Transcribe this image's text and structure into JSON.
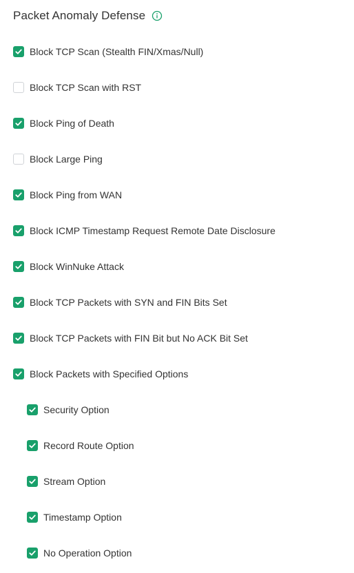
{
  "section": {
    "title": "Packet Anomaly Defense",
    "info_icon": "info-circle-icon"
  },
  "colors": {
    "accent": "#19a06b",
    "text": "#333333",
    "checkbox_border": "#d0d3d7"
  },
  "options": [
    {
      "label": "Block TCP Scan (Stealth FIN/Xmas/Null)",
      "checked": true,
      "level": 0
    },
    {
      "label": "Block TCP Scan with RST",
      "checked": false,
      "level": 0
    },
    {
      "label": "Block Ping of Death",
      "checked": true,
      "level": 0
    },
    {
      "label": "Block Large Ping",
      "checked": false,
      "level": 0
    },
    {
      "label": "Block Ping from WAN",
      "checked": true,
      "level": 0
    },
    {
      "label": "Block ICMP Timestamp Request Remote Date Disclosure",
      "checked": true,
      "level": 0
    },
    {
      "label": "Block WinNuke Attack",
      "checked": true,
      "level": 0
    },
    {
      "label": "Block TCP Packets with SYN and FIN Bits Set",
      "checked": true,
      "level": 0
    },
    {
      "label": "Block TCP Packets with FIN Bit but No ACK Bit Set",
      "checked": true,
      "level": 0
    },
    {
      "label": "Block Packets with Specified Options",
      "checked": true,
      "level": 0
    },
    {
      "label": "Security Option",
      "checked": true,
      "level": 1
    },
    {
      "label": "Record Route Option",
      "checked": true,
      "level": 1
    },
    {
      "label": "Stream Option",
      "checked": true,
      "level": 1
    },
    {
      "label": "Timestamp Option",
      "checked": true,
      "level": 1
    },
    {
      "label": "No Operation Option",
      "checked": true,
      "level": 1
    }
  ]
}
